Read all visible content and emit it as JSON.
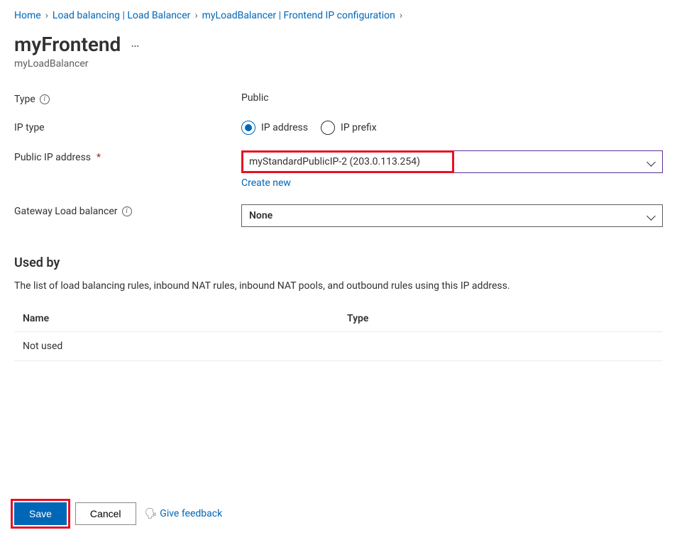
{
  "breadcrumb": {
    "items": [
      {
        "label": "Home"
      },
      {
        "label": "Load balancing | Load Balancer"
      },
      {
        "label": "myLoadBalancer | Frontend IP configuration"
      }
    ]
  },
  "header": {
    "title": "myFrontend",
    "subtitle": "myLoadBalancer"
  },
  "form": {
    "type_label": "Type",
    "type_value": "Public",
    "ip_type_label": "IP type",
    "ip_type_options": {
      "address": "IP address",
      "prefix": "IP prefix"
    },
    "public_ip_label": "Public IP address",
    "public_ip_value": "myStandardPublicIP-2   (203.0.113.254)",
    "create_new": "Create new",
    "gateway_label": "Gateway Load balancer",
    "gateway_value": "None"
  },
  "used_by": {
    "heading": "Used by",
    "description": "The list of load balancing rules, inbound NAT rules, inbound NAT pools, and outbound rules using this IP address.",
    "columns": {
      "name": "Name",
      "type": "Type"
    },
    "rows": [
      {
        "name": "Not used",
        "type": ""
      }
    ]
  },
  "footer": {
    "save": "Save",
    "cancel": "Cancel",
    "feedback": "Give feedback"
  }
}
